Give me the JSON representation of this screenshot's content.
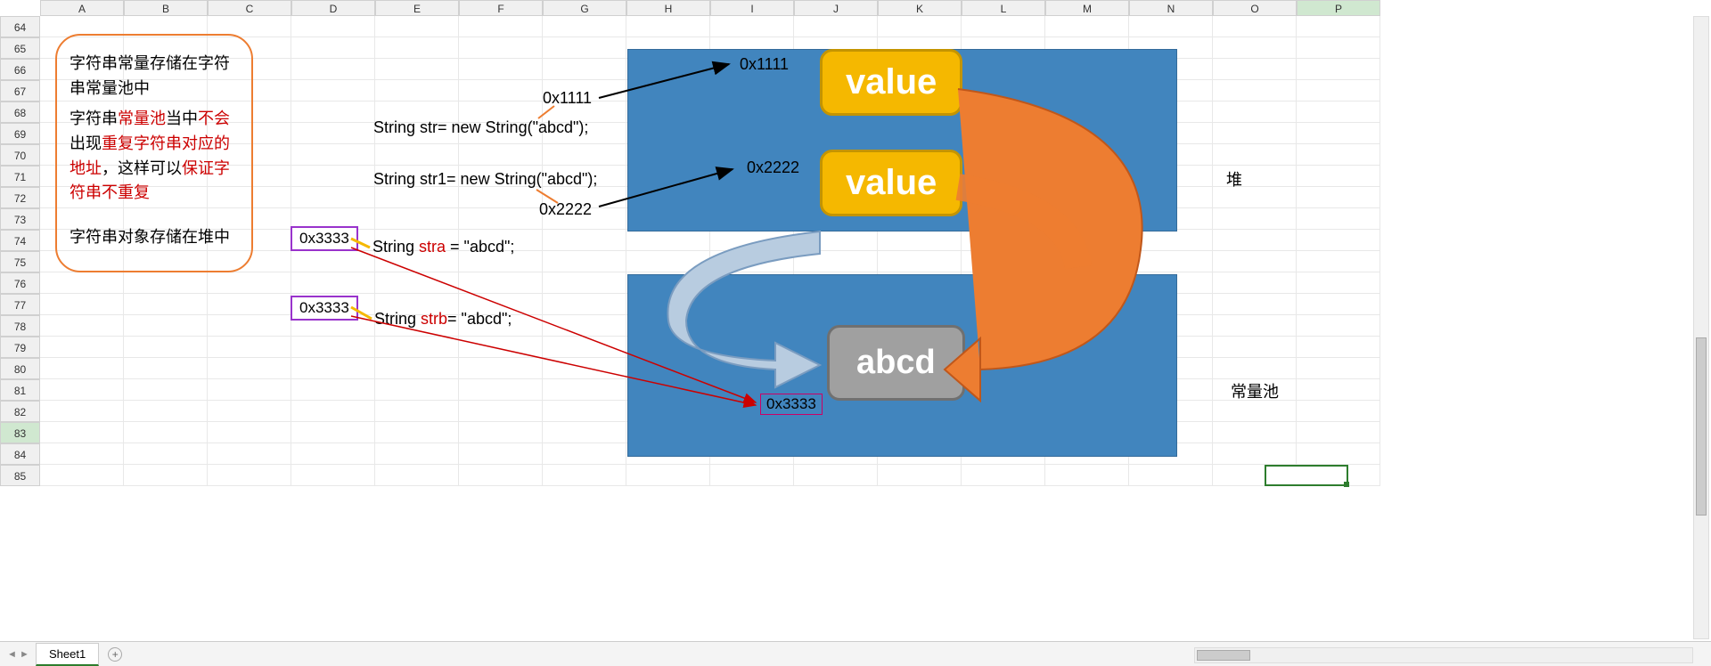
{
  "columns": [
    "A",
    "B",
    "C",
    "D",
    "E",
    "F",
    "G",
    "H",
    "I",
    "J",
    "K",
    "L",
    "M",
    "N",
    "O",
    "P"
  ],
  "rows": [
    64,
    65,
    66,
    67,
    68,
    69,
    70,
    71,
    72,
    73,
    74,
    75,
    76,
    77,
    78,
    79,
    80,
    81,
    82,
    83,
    84,
    85
  ],
  "active_col": "P",
  "active_row": "83",
  "callout": {
    "p1": "字符串常量存储在字符串常量池中",
    "p2_pre": "字符串",
    "p2_r1": "常量池",
    "p2_mid1": "当中",
    "p2_r2": "不会",
    "p2_mid2": "出现",
    "p2_r3": "重复字符串对应的地址",
    "p2_mid3": "，这样可以",
    "p2_r4": "保证字符串不重复",
    "p3": "字符串对象存储在堆中"
  },
  "code": {
    "str": "String str= new String(\"abcd\");",
    "str1": "String str1= new String(\"abcd\");",
    "stra_pre": "String ",
    "stra_var": "stra ",
    "stra_post": "= \"abcd\";",
    "strb_pre": "String ",
    "strb_var": "strb",
    "strb_post": "= \"abcd\";"
  },
  "addresses": {
    "a1": "0x1111",
    "a1_label": "0x1111",
    "a2": "0x2222",
    "a2_label": "0x2222",
    "a3": "0x3333",
    "a3b": "0x3333",
    "a3_ref": "0x3333"
  },
  "badges": {
    "value1": "value",
    "value2": "value",
    "abcd": "abcd"
  },
  "labels": {
    "heap": "堆",
    "pool": "常量池"
  },
  "sheet": {
    "name": "Sheet1"
  }
}
